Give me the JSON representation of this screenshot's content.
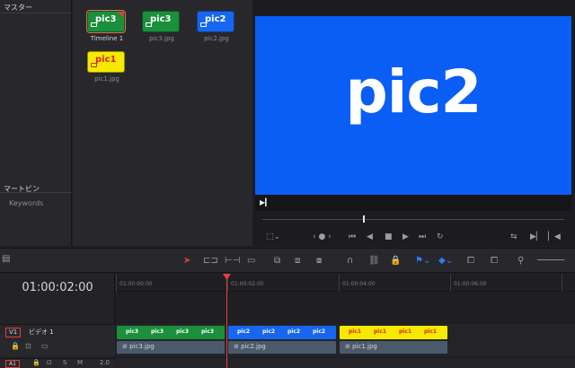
{
  "bins": {
    "master_label": "マスター",
    "smart_bins_label": "マートビン",
    "keywords_label": "Keywords"
  },
  "media_pool": {
    "clips": [
      {
        "thumb_text": "pic3",
        "name": "Timeline 1",
        "color": "#1a8f3c"
      },
      {
        "thumb_text": "pic3",
        "name": "pic3.jpg",
        "color": "#1a8f3c"
      },
      {
        "thumb_text": "pic2",
        "name": "pic2.jpg",
        "color": "#1666f0"
      },
      {
        "thumb_text": "pic1",
        "name": "pic1.jpg",
        "color": "#f5ea00"
      }
    ]
  },
  "viewer": {
    "display_text": "pic2",
    "background": "#0a5df5"
  },
  "timeline": {
    "timecode": "01:00:02:00",
    "ruler_labels": [
      "01:00:00:00",
      "01:00:02:00",
      "01:00:04:00",
      "01:00:06:00"
    ],
    "video_track": {
      "badge": "V1",
      "name": "ビデオ 1"
    },
    "audio_track": {
      "badge": "A1",
      "solo": "S",
      "mute": "M",
      "volume": "2.0"
    },
    "clips": [
      {
        "label": "pic3",
        "name": "pic3.jpg",
        "color": "#1a8f3c",
        "text_color": "#ffffff"
      },
      {
        "label": "pic2",
        "name": "pic2.jpg",
        "color": "#1666f0",
        "text_color": "#ffffff"
      },
      {
        "label": "pic1",
        "name": "pic1.jpg",
        "color": "#f5ea00",
        "text_color": "#d8262b"
      }
    ]
  }
}
